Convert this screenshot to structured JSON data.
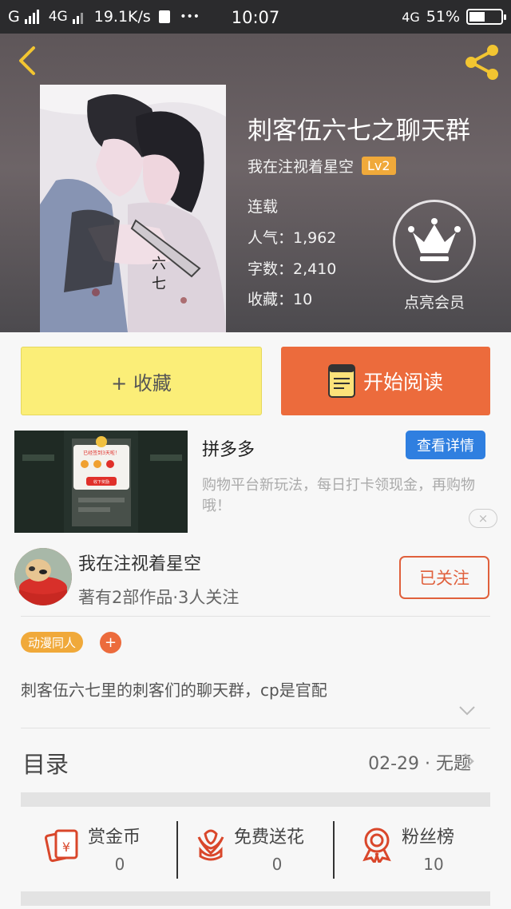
{
  "status_bar": {
    "carrier": "G",
    "network": "4G",
    "speed": "19.1K/s",
    "dots": "•••",
    "time": "10:07",
    "network_right": "4G",
    "battery": "51%",
    "battery_level": 0.51
  },
  "book": {
    "title": "刺客伍六七之聊天群",
    "author": "我在注视着星空",
    "level": "Lv2",
    "status": "连载",
    "popularity": "人气：1,962",
    "word_count": "字数：2,410",
    "favorites": "收藏：10",
    "member_label": "点亮会员"
  },
  "actions": {
    "collect_label": "+ 收藏",
    "read_label": "开始阅读"
  },
  "ad": {
    "title": "拼多多",
    "detail_button": "查看详情",
    "description": "购物平台新玩法，每日打卡领现金，再购物哦！",
    "close": "×",
    "thumb_banner": "已经签到3天啦！",
    "thumb_button": "收下奖励"
  },
  "author_card": {
    "name": "我在注视着星空",
    "meta": "著有2部作品·3人关注",
    "follow_label": "已关注"
  },
  "tags": [
    "动漫同人"
  ],
  "tag_add": "+",
  "description": "刺客伍六七里的刺客们的聊天群，cp是官配",
  "toc": {
    "label": "目录",
    "latest": "02-29 · 无题"
  },
  "stats": [
    {
      "label": "赏金币",
      "value": "0",
      "icon": "red-envelope-icon"
    },
    {
      "label": "免费送花",
      "value": "0",
      "icon": "flower-icon"
    },
    {
      "label": "粉丝榜",
      "value": "10",
      "icon": "ribbon-medal-icon"
    }
  ],
  "colors": {
    "accent_orange": "#ec6b3c",
    "collect_yellow": "#fbee78",
    "level_badge": "#f0a93a",
    "ad_button_blue": "#2f7fe0",
    "icon_red": "#d9472b"
  }
}
